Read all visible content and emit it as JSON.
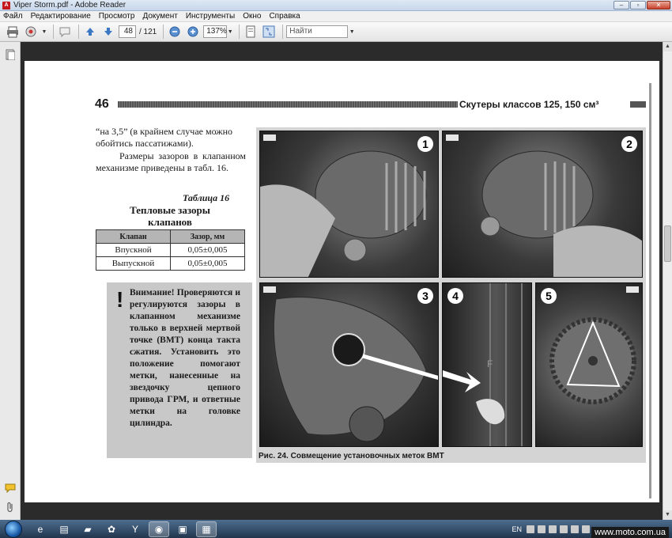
{
  "window": {
    "title": "Viper Storm.pdf - Adobe Reader"
  },
  "menu": [
    "Файл",
    "Редактирование",
    "Просмотр",
    "Документ",
    "Инструменты",
    "Окно",
    "Справка"
  ],
  "toolbar": {
    "page_current": "48",
    "page_total": "/ 121",
    "zoom": "137%",
    "search_placeholder": "Найти"
  },
  "document": {
    "page_number": "46",
    "header_title": "Скутеры классов 125, 150 см³",
    "para1": "“на 3,5” (в крайнем случае можно обойтись пассатижами).",
    "para2": "Размеры зазоров в клапанном механизме приведены в табл. 16.",
    "table_caption": "Таблица 16",
    "table_title": "Тепловые зазоры клапанов",
    "table": {
      "headers": [
        "Клапан",
        "Зазор, мм"
      ],
      "rows": [
        [
          "Впускной",
          "0,05±0,005"
        ],
        [
          "Выпускной",
          "0,05±0,005"
        ]
      ]
    },
    "warning_mark": "!",
    "warning_text": "Внимание! Проверяются и регулируются зазоры в клапанном механизме только в верхней мертвой точке (ВМТ) конца такта сжатия. Установить это положение помогают метки, нанесенные на звездочку цепного привода ГРМ, и ответные метки на головке цилиндра.",
    "figure_caption": "Рис. 24. Совмещение установочных меток ВМТ",
    "photo_numbers": [
      "1",
      "2",
      "3",
      "4",
      "5"
    ]
  },
  "taskbar": {
    "lang": "EN"
  },
  "watermark": "www.moto.com.ua"
}
